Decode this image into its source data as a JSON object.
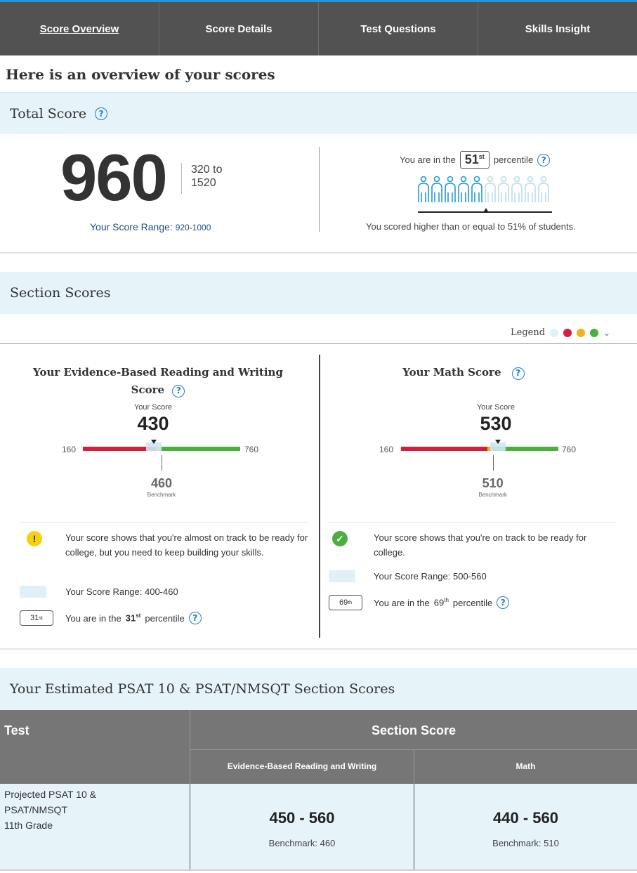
{
  "nav": {
    "tabs": [
      "Score Overview",
      "Score Details",
      "Test Questions",
      "Skills Insight"
    ],
    "active": "Score Overview"
  },
  "heading": "Here is an overview of your scores",
  "total": {
    "title": "Total Score",
    "score": "960",
    "scale_from": "320 to",
    "scale_to": "1520",
    "range_label": "Your Score Range:",
    "range_value": "920-1000",
    "percentile_prefix": "You are in the",
    "percentile_num": "51",
    "percentile_suffix": "st",
    "percentile_word": "percentile",
    "percentile_value": 51,
    "people_total": 10,
    "people_filled": 5,
    "caption": "You scored higher than or equal to 51% of students."
  },
  "sections": {
    "title": "Section Scores",
    "legend_label": "Legend",
    "colors": {
      "range": "#dff0f7",
      "red": "#d21f3c",
      "yellow": "#f2b21a",
      "green": "#4caf3d"
    },
    "ebrw": {
      "title_line1": "Your Evidence-Based Reading and Writing",
      "title_line2": "Score",
      "your_score_label": "Your Score",
      "score": "430",
      "min": "160",
      "max": "760",
      "benchmark": "460",
      "benchmark_label": "Benchmark",
      "score_value": 430,
      "benchmark_value": 460,
      "range_low": 400,
      "range_high": 460,
      "status": "almost-on-track",
      "message": "Your score shows that you're almost on track to be ready for college, but you need to keep building your skills.",
      "range_text": "Your Score Range: 400-460",
      "percentile_chip": "31",
      "percentile_sup": "st",
      "percentile_prefix": "You are in the",
      "percentile_suffix": "percentile"
    },
    "math": {
      "title": "Your Math Score",
      "your_score_label": "Your Score",
      "score": "530",
      "min": "160",
      "max": "760",
      "benchmark": "510",
      "benchmark_label": "Benchmark",
      "score_value": 530,
      "benchmark_value": 510,
      "range_low": 500,
      "range_high": 560,
      "status": "on-track",
      "message": "Your score shows that you're on track to be ready for college.",
      "range_text": "Your Score Range: 500-560",
      "percentile_chip": "69",
      "percentile_sup": "th",
      "percentile_prefix": "You are in the",
      "percentile_suffix": "percentile"
    }
  },
  "estimate": {
    "title": "Your Estimated PSAT 10 & PSAT/NMSQT Section Scores",
    "col_test": "Test",
    "col_section": "Section Score",
    "col_ebrw": "Evidence-Based Reading and Writing",
    "col_math": "Math",
    "row_label_1": "Projected  PSAT 10 &",
    "row_label_2": "PSAT/NMSQT",
    "row_label_3": "11th Grade",
    "ebrw_range": "450 - 560",
    "ebrw_bench": "Benchmark: 460",
    "math_range": "440 - 560",
    "math_bench": "Benchmark: 510"
  }
}
